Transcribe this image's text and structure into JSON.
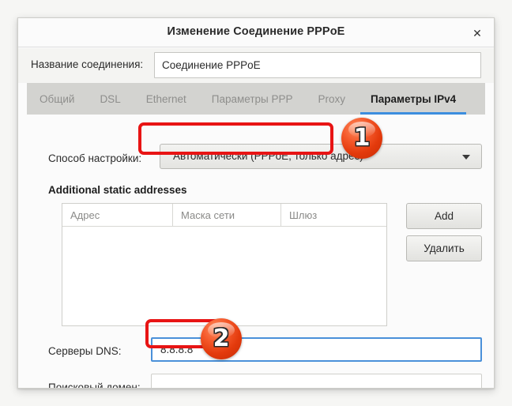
{
  "window": {
    "title": "Изменение Соединение PPPoE",
    "close_icon": "close-icon",
    "close_glyph": "✕"
  },
  "connection_name": {
    "label": "Название соединения:",
    "value": "Соединение PPPoE",
    "placeholder": ""
  },
  "tabs": [
    {
      "label": "Общий",
      "active": false
    },
    {
      "label": "DSL",
      "active": false
    },
    {
      "label": "Ethernet",
      "active": false
    },
    {
      "label": "Параметры PPP",
      "active": false
    },
    {
      "label": "Proxy",
      "active": false
    },
    {
      "label": "Параметры IPv4",
      "active": true
    }
  ],
  "method": {
    "label": "Способ настройки:",
    "selected": "Автоматически (PPPoE, только адрес)",
    "arrow_icon": "chevron-down-icon"
  },
  "static_addresses": {
    "title": "Additional static addresses",
    "columns": [
      "Адрес",
      "Маска сети",
      "Шлюз"
    ],
    "rows": [],
    "add_button": "Add",
    "delete_button": "Удалить"
  },
  "dns": {
    "label": "Серверы DNS:",
    "value": "8.8.8.8",
    "placeholder": ""
  },
  "search_domain": {
    "label": "Поисковый домен:",
    "value": "",
    "placeholder": ""
  },
  "annotations": {
    "badge_1": "1",
    "badge_2": "2"
  },
  "colors": {
    "accent_tab_underline": "#3c8ede",
    "focus_border": "#4a90d9",
    "highlight_red": "#e81414",
    "badge_orange": "#e33a0c"
  }
}
